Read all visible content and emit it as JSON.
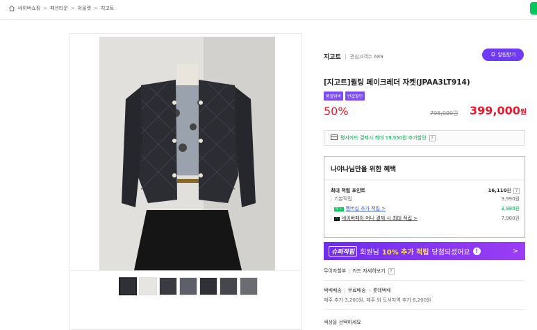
{
  "breadcrumb": {
    "home_icon": "home-icon",
    "items": [
      "네이버쇼핑",
      "패션타운",
      "아울렛",
      "지고트"
    ],
    "separator": ">"
  },
  "store": {
    "name": "지고트",
    "fans": "관심고객수 689",
    "alarm_label": "알림받기"
  },
  "product": {
    "title": "[지고트]퀼팅 페이크레더 자켓(JPAA3LT914)",
    "tags": [
      "품절임박",
      "반값할인"
    ],
    "discount": "50%",
    "original_price": "798,000원",
    "sale_price": "399,000",
    "sale_unit": "원"
  },
  "card_promo": {
    "text": "평사카드 결제시 최대 19,950원 추가할인",
    "help": "?"
  },
  "benefit": {
    "title": "나야나님만을 위한 혜택",
    "max_points_label": "최대 적립 포인트",
    "max_points_value": "16,110",
    "max_points_unit": "원",
    "help": "?",
    "rows": [
      {
        "label": "기본적립",
        "value": "3,990원"
      },
      {
        "label": "멤버십 추가 적립 >",
        "badge": "N +",
        "value": "3,990원"
      },
      {
        "label": "네이버페이 머니 결제 시 최대 적립 >",
        "badge": "N",
        "value": "7,980원"
      }
    ]
  },
  "super_bar": {
    "badge": "슈퍼적립",
    "text_before": "회원님",
    "highlight": "10% 추가 적립",
    "text_after": "당첨되셨어요",
    "warn": "!",
    "arrow": ">"
  },
  "installment": {
    "label": "무이자할부",
    "link": "카드 자세히보기",
    "help": "?"
  },
  "shipping": {
    "label": "택배배송",
    "fee": "무료배송",
    "carrier": "롯데택배",
    "extra": "제주 추가 3,200원, 제주 외 도서지역 추가 6,200원"
  },
  "option_prompt": "색상을 선택하세요",
  "colors": {
    "accent": "#6f3bf5",
    "price": "#f0162b",
    "naver_green": "#03c75a"
  }
}
